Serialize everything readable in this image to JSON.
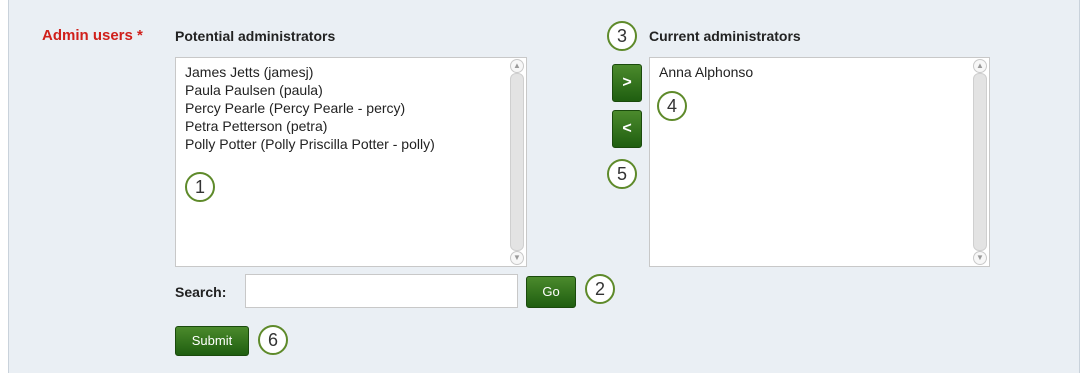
{
  "admin_users_label": "Admin users *",
  "potential": {
    "heading": "Potential administrators",
    "items": [
      "James Jetts (jamesj)",
      "Paula Paulsen (paula)",
      "Percy Pearle (Percy Pearle - percy)",
      "Petra Petterson (petra)",
      "Polly Potter (Polly Priscilla Potter - polly)"
    ]
  },
  "current": {
    "heading": "Current administrators",
    "items": [
      "Anna Alphonso"
    ]
  },
  "buttons": {
    "add": ">",
    "remove": "<",
    "go": "Go",
    "submit": "Submit"
  },
  "search": {
    "label": "Search:",
    "value": "",
    "placeholder": ""
  },
  "callouts": {
    "c1": "1",
    "c2": "2",
    "c3": "3",
    "c4": "4",
    "c5": "5",
    "c6": "6"
  },
  "colors": {
    "required_label": "#d0201b",
    "button_green": "#2e6b1a",
    "callout_border": "#5e8a2a",
    "panel_background": "#eaeff4"
  },
  "icons": {
    "scroll_up": "scroll-up-arrow-icon",
    "scroll_down": "scroll-down-arrow-icon"
  }
}
